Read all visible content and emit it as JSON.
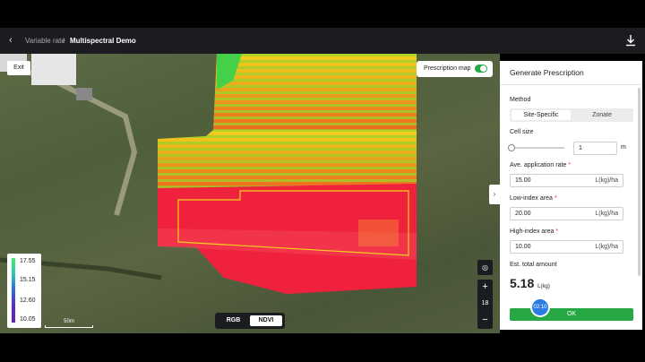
{
  "breadcrumb": {
    "parent": "Variable rate",
    "separator": "/",
    "current": "Multispectral Demo"
  },
  "map": {
    "exit_label": "Exit",
    "prescription_toggle_label": "Prescription map",
    "prescription_toggle_on": true,
    "legend_values": [
      "17.55",
      "15.15",
      "12.60",
      "10.05"
    ],
    "scale_label": "50m",
    "layers": [
      "RGB",
      "NDVI"
    ],
    "active_layer": "NDVI",
    "zoom_level": "18",
    "zoom_in": "+",
    "zoom_out": "−",
    "collapse_icon": "›"
  },
  "panel": {
    "title": "Generate Prescription",
    "method_label": "Method",
    "method_options": [
      "Site-Specific",
      "Zonate"
    ],
    "method_selected": "Site-Specific",
    "cell_size_label": "Cell size",
    "cell_size_value": "1",
    "cell_size_unit": "m",
    "ave_rate_label": "Ave. application rate",
    "ave_rate_value": "15.00",
    "low_index_label": "Low-index area",
    "low_index_value": "20.00",
    "high_index_label": "High-index area",
    "high_index_value": "10.00",
    "rate_unit": "L(kg)/ha",
    "required_mark": "*",
    "total_label": "Est. total amount",
    "total_value": "5.18",
    "total_unit": "L(kg)",
    "ok_label": "OK",
    "badge_text": "02:10"
  },
  "colors": {
    "accent": "#27a844",
    "topbar": "#1b1c1f",
    "badge": "#2c7be5"
  }
}
